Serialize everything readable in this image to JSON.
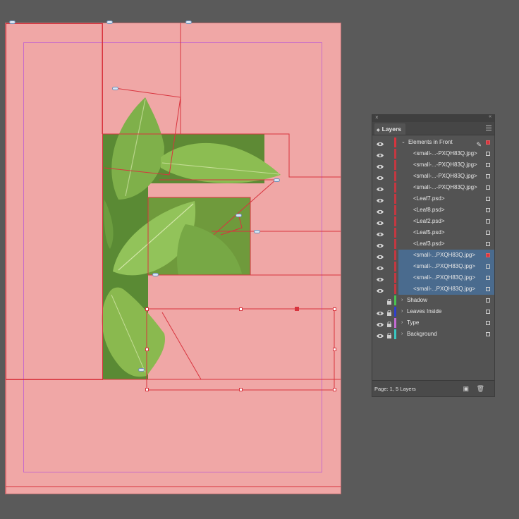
{
  "layers_panel": {
    "tab_label": "Layers",
    "close_glyph": "×",
    "collapse_glyph": "«",
    "menu_icon": "panel-menu-icon",
    "active_layer": {
      "label": "Elements in Front",
      "expanded_glyph": "⌄",
      "color": "#d8343e",
      "edit_glyph": "✎"
    },
    "sublayers": [
      {
        "label": "<small-...-PXQH83Q.jpg>",
        "selected": false
      },
      {
        "label": "<small-...-PXQH83Q.jpg>",
        "selected": false
      },
      {
        "label": "<small-...-PXQH83Q.jpg>",
        "selected": false
      },
      {
        "label": "<small-...-PXQH83Q.jpg>",
        "selected": false
      },
      {
        "label": "<Leaf7.psd>",
        "selected": false
      },
      {
        "label": "<Leaf8.psd>",
        "selected": false
      },
      {
        "label": "<Leaf2.psd>",
        "selected": false
      },
      {
        "label": "<Leaf5.psd>",
        "selected": false
      },
      {
        "label": "<Leaf3.psd>",
        "selected": false
      },
      {
        "label": "<small-...PXQH83Q.jpg>",
        "selected": true
      },
      {
        "label": "<small-...PXQH83Q.jpg>",
        "selected": true
      },
      {
        "label": "<small-...PXQH83Q.jpg>",
        "selected": true
      },
      {
        "label": "<small-...PXQH83Q.jpg>",
        "selected": true
      }
    ],
    "top_layers": [
      {
        "label": "Shadow",
        "color": "#49c351",
        "eye": false
      },
      {
        "label": "Leaves Inside",
        "color": "#2f3fd0",
        "eye": true
      },
      {
        "label": "Type",
        "color": "#c46bd2",
        "eye": true
      },
      {
        "label": "Background",
        "color": "#39c7c2",
        "eye": true
      }
    ],
    "collapsed_glyph": "›",
    "footer": {
      "status": "Page: 1, 5 Layers",
      "new_layer_icon": "new-layer-icon",
      "delete_icon": "trash-icon"
    }
  },
  "colors": {
    "page": "#f0a7a6",
    "pasteboard": "#5a5a5a",
    "frame": "#d8343e",
    "margin": "#c86cc9",
    "selection": "#4a6b8e"
  }
}
